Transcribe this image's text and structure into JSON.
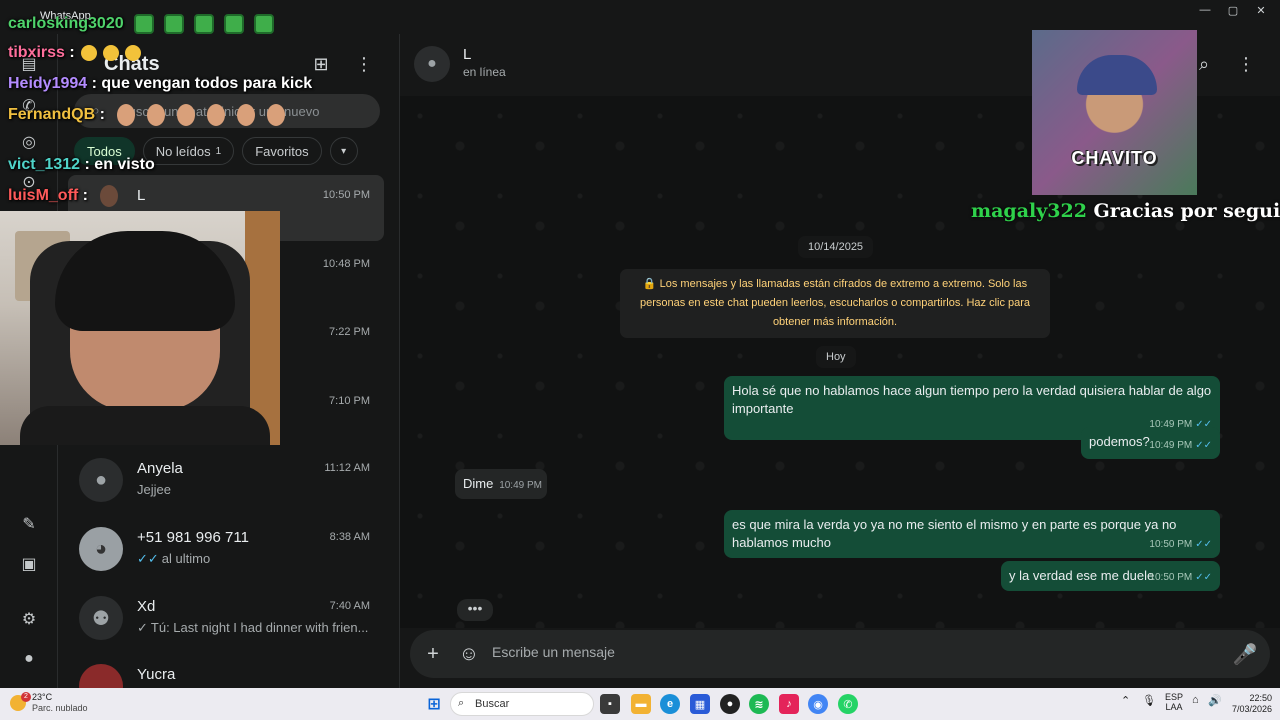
{
  "window": {
    "app_name": "WhatsApp",
    "controls": [
      "—",
      "▢",
      "✕"
    ]
  },
  "rail": {
    "icons": [
      "chats-icon",
      "status-icon",
      "channels-icon",
      "communities-icon",
      "meta-ai-icon",
      "media-icon",
      "settings-icon",
      "profile-icon"
    ]
  },
  "chat_list": {
    "title": "Chats",
    "search_placeholder": "Buscar un chat o iniciar uno nuevo",
    "filters": [
      {
        "label": "Todos",
        "count": ""
      },
      {
        "label": "No leídos",
        "count": "1"
      },
      {
        "label": "Favoritos",
        "count": ""
      }
    ],
    "items": [
      {
        "name": "L",
        "time": "10:50 PM",
        "preview": ""
      },
      {
        "name": "",
        "time": "10:48 PM",
        "preview": ""
      },
      {
        "name": "",
        "time": "7:22 PM",
        "preview": ""
      },
      {
        "name": "",
        "time": "7:10 PM",
        "preview": ""
      },
      {
        "name": "Anyela",
        "time": "11:12 AM",
        "preview": "Jejjee"
      },
      {
        "name": "+51 981 996 711",
        "time": "8:38 AM",
        "preview": "al ultimo"
      },
      {
        "name": "Xd",
        "time": "7:40 AM",
        "preview": "Tú: Last night I had dinner with frien..."
      },
      {
        "name": "Yucra",
        "time": "",
        "preview": ""
      }
    ]
  },
  "conversation": {
    "contact_name": "L",
    "status": "en línea",
    "date_chip": "10/14/2025",
    "encryption_notice": "🔒 Los mensajes y las llamadas están cifrados de extremo a extremo. Solo las personas en este chat pueden leerlos, escucharlos o compartirlos. Haz clic para obtener más información.",
    "today_chip": "Hoy",
    "messages": [
      {
        "dir": "out",
        "text": "Hola sé que no hablamos hace algun tiempo pero la verdad quisiera hablar de algo importante",
        "time": "10:49 PM"
      },
      {
        "dir": "out",
        "text": "podemos?",
        "time": "10:49 PM"
      },
      {
        "dir": "in",
        "text": "Dime",
        "time": "10:49 PM"
      },
      {
        "dir": "out",
        "text": "es que mira la verda yo ya no me siento el mismo y en parte es porque ya no hablamos mucho",
        "time": "10:50 PM"
      },
      {
        "dir": "out",
        "text": "y la verdad ese me duele",
        "time": "10:50 PM"
      }
    ],
    "typing_indicator": "•••",
    "composer_placeholder": "Escribe un mensaje"
  },
  "stream_overlay": {
    "chat": [
      {
        "user": "carlosking3020",
        "user_color": "#4fd36b",
        "sep": "",
        "msg": ""
      },
      {
        "user": "tibxirss",
        "user_color": "#ff6f9c",
        "sep": " :",
        "msg": ""
      },
      {
        "user": "Heidy1994",
        "user_color": "#b48cff",
        "sep": " :",
        "msg": " que vengan todos para kick"
      },
      {
        "user": "FernandQB",
        "user_color": "#f0c040",
        "sep": " :",
        "msg": ""
      },
      {
        "user": "vict_1312",
        "user_color": "#4fd3c8",
        "sep": " :",
        "msg": " en visto"
      },
      {
        "user": "luisM_off",
        "user_color": "#ff5a5a",
        "sep": " :",
        "msg": ""
      }
    ],
    "alert_thumb_label": "CHAVITO",
    "follow_user": "magaly322",
    "follow_text": " Gracias por seguirme!!"
  },
  "taskbar": {
    "weather_temp": "23°C",
    "weather_cond": "Parc. nublado",
    "weather_badge": "2",
    "search_placeholder": "Buscar",
    "lang": "ESP",
    "lang_sub": "LAA",
    "time": "22:50",
    "date": "7/03/2026"
  }
}
